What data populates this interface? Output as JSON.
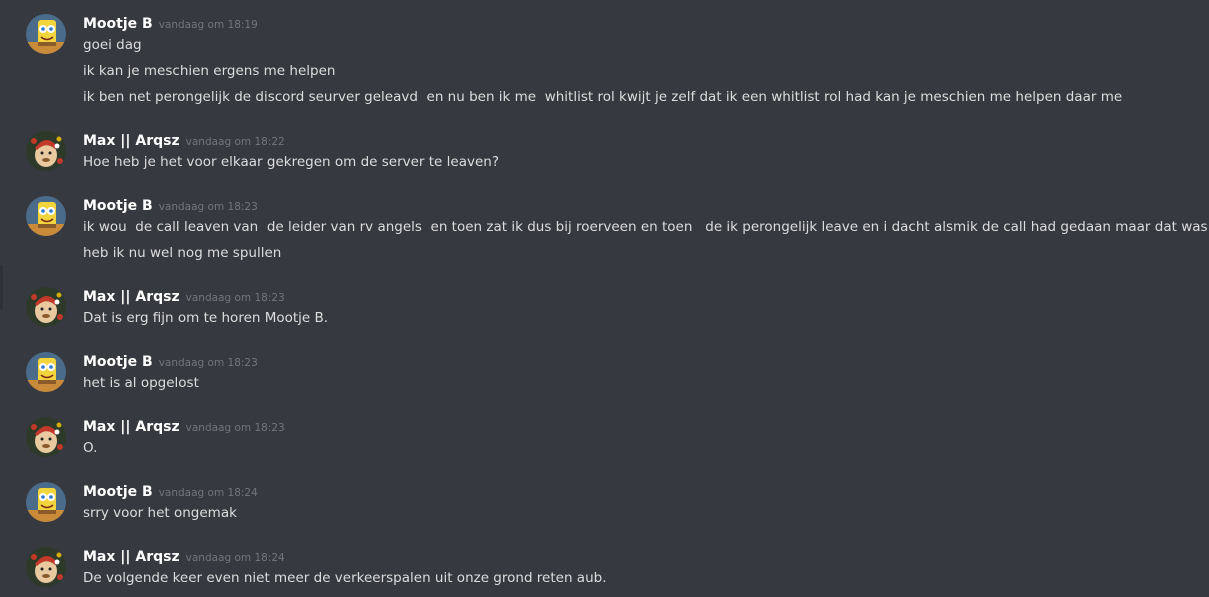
{
  "colors": {
    "background": "#36393f",
    "username": "#ffffff",
    "timestamp": "#72767d",
    "text": "#dcddde"
  },
  "messages": [
    {
      "author": "Mootje B",
      "avatar": "spongebob-avatar-icon",
      "time": "vandaag om 18:19",
      "lines": [
        "goei dag",
        "ik kan je meschien ergens me helpen",
        "ik ben net perongelijk de discord seurver geleavd  en nu ben ik me  whitlist rol kwijt je zelf dat ik een whitlist rol had kan je meschien me helpen daar me"
      ]
    },
    {
      "author": "Max || Arqsz",
      "avatar": "christmas-character-avatar-icon",
      "time": "vandaag om 18:22",
      "lines": [
        "Hoe heb je het voor elkaar gekregen om de server te leaven?"
      ]
    },
    {
      "author": "Mootje B",
      "avatar": "spongebob-avatar-icon",
      "time": "vandaag om 18:23",
      "lines": [
        "ik wou  de call leaven van  de leider van rv angels  en toen zat ik dus bij roerveen en toen   de ik perongelijk leave en i dacht alsmik de call had gedaan maar dat was ik niet",
        "heb ik nu wel nog me spullen"
      ]
    },
    {
      "author": "Max || Arqsz",
      "avatar": "christmas-character-avatar-icon",
      "time": "vandaag om 18:23",
      "lines": [
        "Dat is erg fijn om te horen Mootje B."
      ]
    },
    {
      "author": "Mootje B",
      "avatar": "spongebob-avatar-icon",
      "time": "vandaag om 18:23",
      "lines": [
        "het is al opgelost"
      ]
    },
    {
      "author": "Max || Arqsz",
      "avatar": "christmas-character-avatar-icon",
      "time": "vandaag om 18:23",
      "lines": [
        "O."
      ]
    },
    {
      "author": "Mootje B",
      "avatar": "spongebob-avatar-icon",
      "time": "vandaag om 18:24",
      "lines": [
        "srry voor het ongemak"
      ]
    },
    {
      "author": "Max || Arqsz",
      "avatar": "christmas-character-avatar-icon",
      "time": "vandaag om 18:24",
      "lines": [
        "De volgende keer even niet meer de verkeerspalen uit onze grond reten aub."
      ]
    }
  ]
}
